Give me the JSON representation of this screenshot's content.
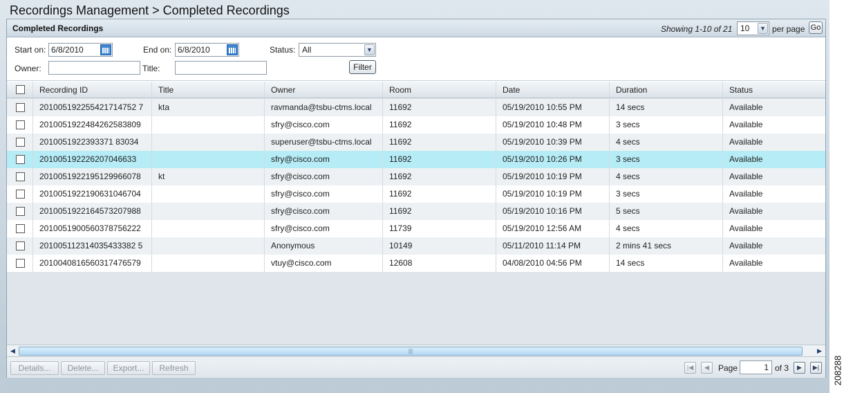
{
  "page_title": "Recordings Management > Completed Recordings",
  "panel": {
    "title": "Completed Recordings",
    "showing": "Showing 1-10 of 21",
    "per_page_value": "10",
    "per_page_label": "per page",
    "go_label": "Go"
  },
  "filters": {
    "start_label": "Start on:",
    "start_value": "6/8/2010",
    "end_label": "End on:",
    "end_value": "6/8/2010",
    "status_label": "Status:",
    "status_value": "All",
    "owner_label": "Owner:",
    "owner_value": "",
    "title_label": "Title:",
    "title_value": "",
    "filter_button": "Filter"
  },
  "table": {
    "columns": [
      "Recording ID",
      "Title",
      "Owner",
      "Room",
      "Date",
      "Duration",
      "Status"
    ],
    "selected_row": 3,
    "rows": [
      [
        "201005192255421714752 7",
        "kta",
        "ravmanda@tsbu-ctms.local",
        "11692",
        "05/19/2010 10:55 PM",
        "14 secs",
        "Available"
      ],
      [
        "2010051922484262583809",
        "",
        "sfry@cisco.com",
        "11692",
        "05/19/2010 10:48 PM",
        "3 secs",
        "Available"
      ],
      [
        "2010051922393371 83034",
        "",
        "superuser@tsbu-ctms.local",
        "11692",
        "05/19/2010 10:39 PM",
        "4 secs",
        "Available"
      ],
      [
        "201005192226207046633",
        "",
        "sfry@cisco.com",
        "11692",
        "05/19/2010 10:26 PM",
        "3 secs",
        "Available"
      ],
      [
        "2010051922195129966078",
        "kt",
        "sfry@cisco.com",
        "11692",
        "05/19/2010 10:19 PM",
        "4 secs",
        "Available"
      ],
      [
        "2010051922190631046704",
        "",
        "sfry@cisco.com",
        "11692",
        "05/19/2010 10:19 PM",
        "3 secs",
        "Available"
      ],
      [
        "2010051922164573207988",
        "",
        "sfry@cisco.com",
        "11692",
        "05/19/2010 10:16 PM",
        "5 secs",
        "Available"
      ],
      [
        "2010051900560378756222",
        "",
        "sfry@cisco.com",
        "11739",
        "05/19/2010 12:56 AM",
        "4 secs",
        "Available"
      ],
      [
        "201005112314035433382 5",
        "",
        "Anonymous",
        "10149",
        "05/11/2010 11:14 PM",
        "2 mins 41 secs",
        "Available"
      ],
      [
        "2010040816560317476579",
        "",
        "vtuy@cisco.com",
        "12608",
        "04/08/2010 04:56 PM",
        "14 secs",
        "Available"
      ]
    ]
  },
  "footer": {
    "details": "Details...",
    "delete": "Delete...",
    "export": "Export...",
    "refresh": "Refresh",
    "page_label": "Page",
    "page_value": "1",
    "of_pages": "of 3"
  },
  "figure_number": "208288"
}
